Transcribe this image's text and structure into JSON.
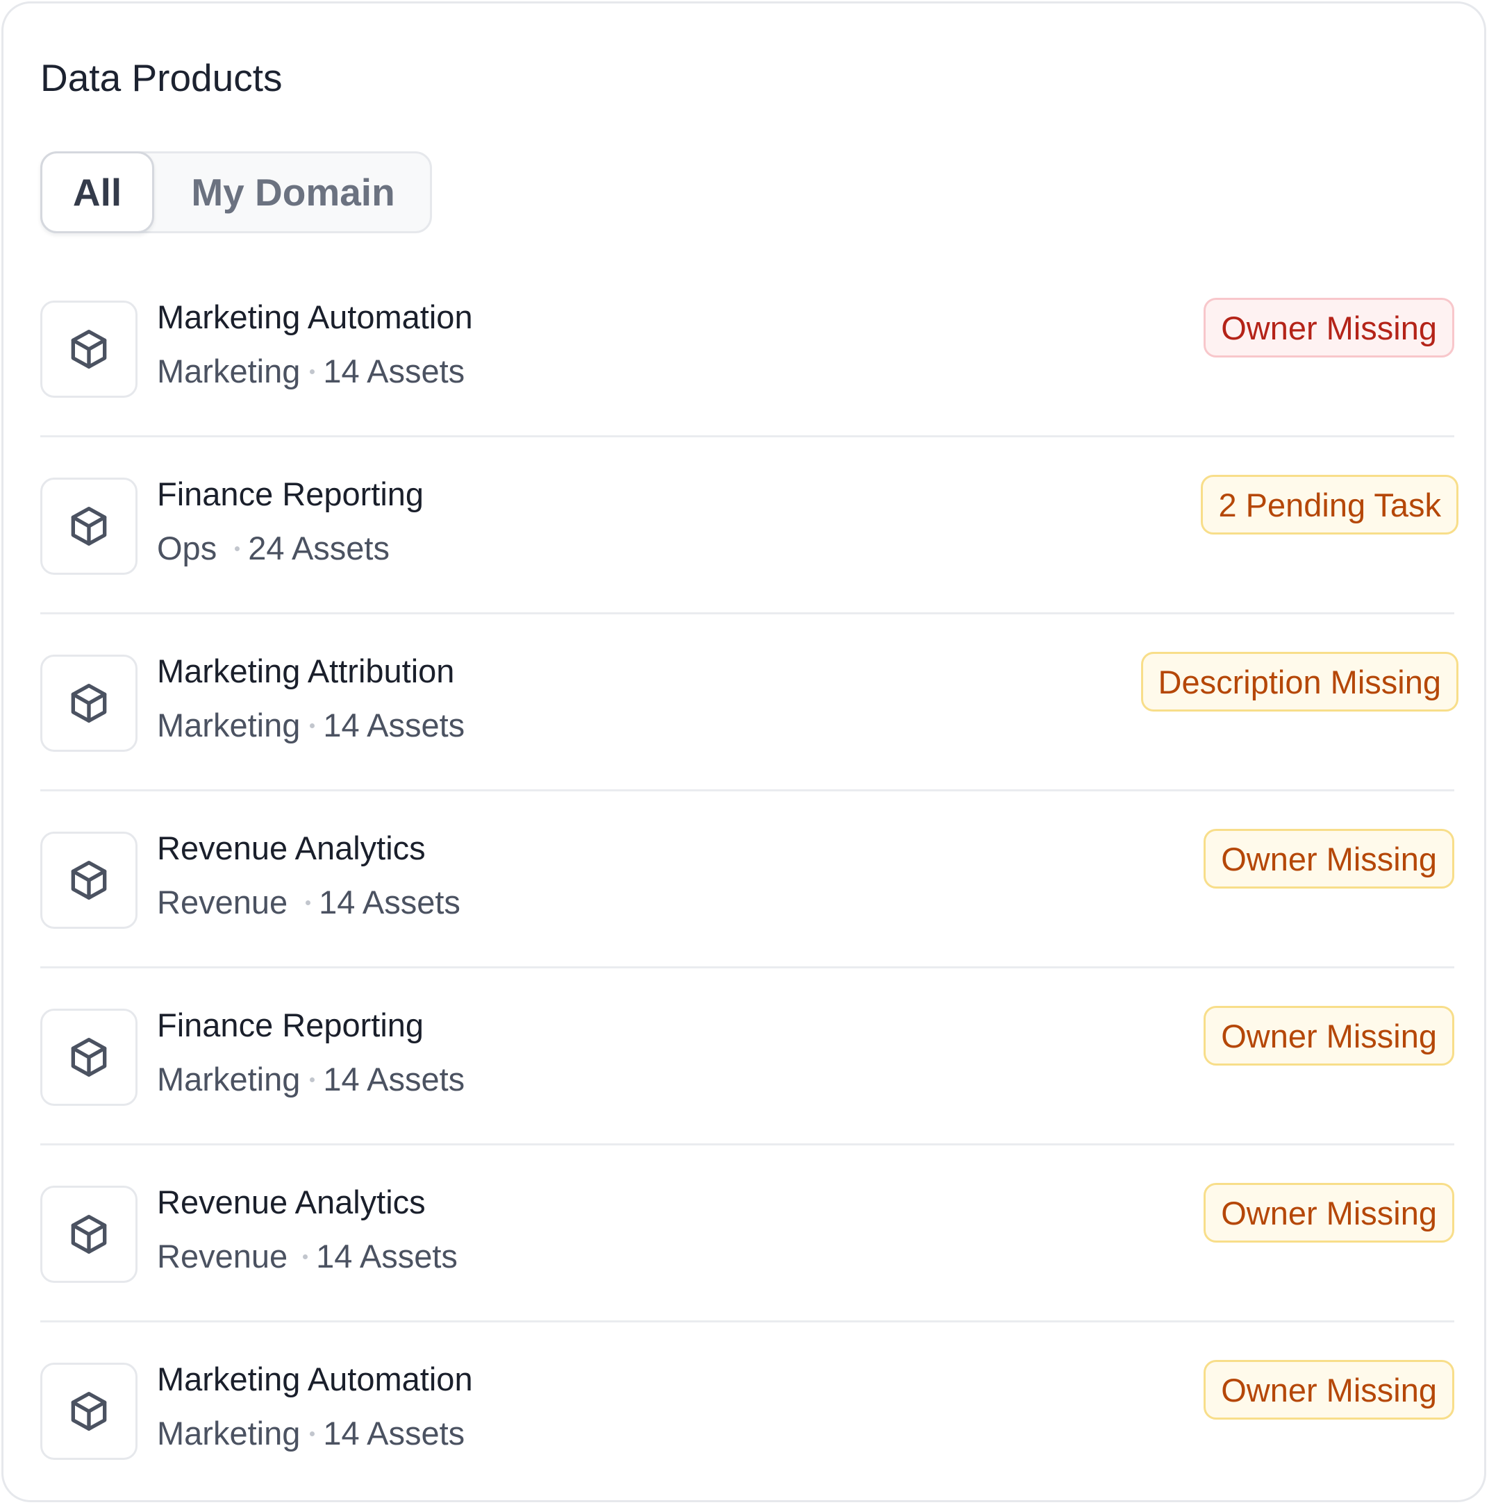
{
  "header": {
    "title": "Data Products"
  },
  "tabs": [
    {
      "label": "All",
      "selected": true
    },
    {
      "label": "My Domain",
      "selected": false
    }
  ],
  "icons": {
    "product": "cube-icon"
  },
  "colors": {
    "red_badge_text": "#b42318",
    "red_badge_bg": "#fef2f2",
    "amber_badge_text": "#b54708",
    "amber_badge_bg": "#fffaeb"
  },
  "products": [
    {
      "name": "Marketing Automation",
      "domain": "Marketing",
      "assets": "14 Assets",
      "badge": "Owner Missing",
      "badge_tone": "red"
    },
    {
      "name": "Finance Reporting",
      "domain": "Ops",
      "assets": "24 Assets",
      "badge": "2 Pending Task",
      "badge_tone": "amber"
    },
    {
      "name": "Marketing Attribution",
      "domain": "Marketing",
      "assets": "14 Assets",
      "badge": "Description Missing",
      "badge_tone": "amber"
    },
    {
      "name": "Revenue Analytics",
      "domain": "Revenue",
      "assets": "14 Assets",
      "badge": "Owner Missing",
      "badge_tone": "amber"
    },
    {
      "name": "Finance Reporting",
      "domain": "Marketing",
      "assets": "14 Assets",
      "badge": "Owner Missing",
      "badge_tone": "amber"
    },
    {
      "name": "Revenue Analytics",
      "domain": "Revenue",
      "assets": "14 Assets",
      "badge": "Owner Missing",
      "badge_tone": "amber"
    },
    {
      "name": "Marketing Automation",
      "domain": "Marketing",
      "assets": "14 Assets",
      "badge": "Owner Missing",
      "badge_tone": "amber"
    }
  ]
}
